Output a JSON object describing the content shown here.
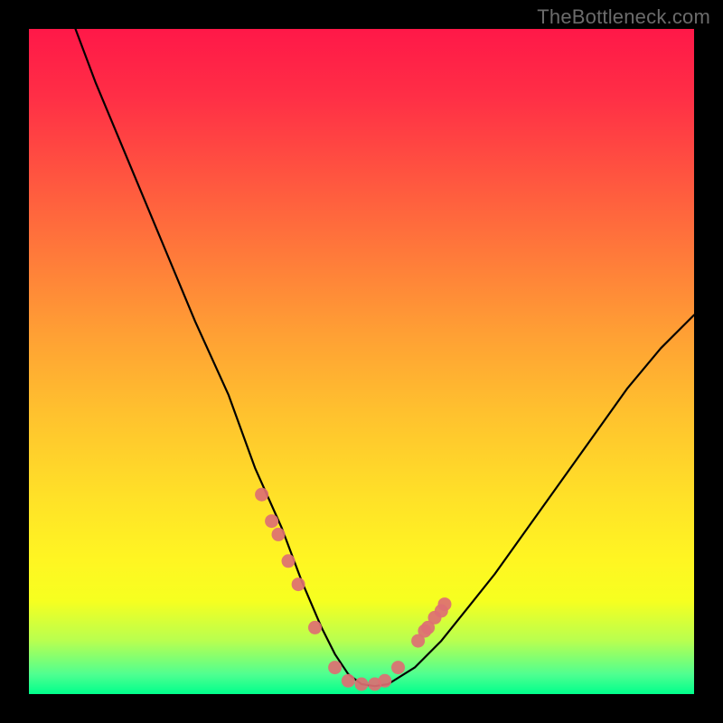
{
  "watermark": "TheBottleneck.com",
  "chart_data": {
    "type": "line",
    "title": "",
    "xlabel": "",
    "ylabel": "",
    "xlim": [
      0,
      100
    ],
    "ylim": [
      0,
      100
    ],
    "series": [
      {
        "name": "curve",
        "x": [
          7,
          10,
          15,
          20,
          25,
          30,
          34,
          38,
          41,
          44,
          46,
          48,
          50,
          52,
          54,
          58,
          62,
          66,
          70,
          75,
          80,
          85,
          90,
          95,
          100
        ],
        "y": [
          100,
          92,
          80,
          68,
          56,
          45,
          34,
          25,
          17,
          10,
          6,
          3,
          1.5,
          1.2,
          1.5,
          4,
          8,
          13,
          18,
          25,
          32,
          39,
          46,
          52,
          57
        ]
      }
    ],
    "markers": {
      "name": "points",
      "color": "#dd6f73",
      "x": [
        35,
        36.5,
        37.5,
        39,
        40.5,
        43,
        46,
        48,
        50,
        52,
        53.5,
        55.5,
        58.5,
        59.5,
        60,
        61,
        62,
        62.5
      ],
      "y": [
        30,
        26,
        24,
        20,
        16.5,
        10,
        4,
        2,
        1.5,
        1.5,
        2,
        4,
        8,
        9.5,
        10,
        11.5,
        12.5,
        13.5
      ]
    }
  }
}
